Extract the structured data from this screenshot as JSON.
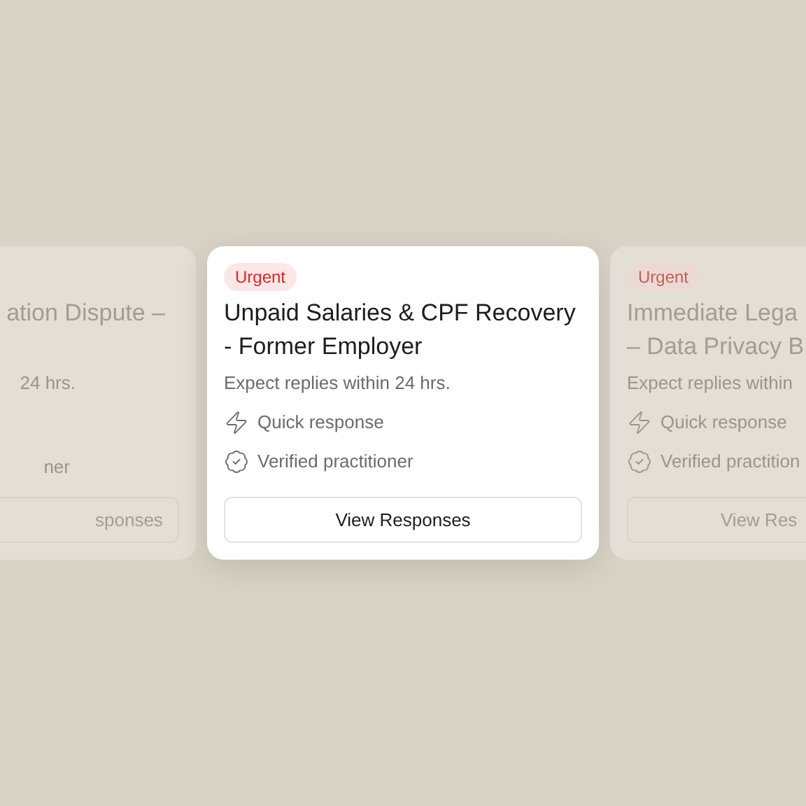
{
  "cards": [
    {
      "kind": "left",
      "title_lines": [
        "ation Dispute –"
      ],
      "subtitle": "24 hrs.",
      "features": [
        {
          "kind": "verified",
          "label": "ner"
        }
      ],
      "button": "sponses"
    },
    {
      "kind": "center",
      "badge": "Urgent",
      "title_lines": [
        "Unpaid Salaries & CPF Recovery",
        "- Former Employer"
      ],
      "subtitle": "Expect replies within 24 hrs.",
      "features": [
        {
          "kind": "quick",
          "label": "Quick response"
        },
        {
          "kind": "verified",
          "label": "Verified practitioner"
        }
      ],
      "button": "View Responses"
    },
    {
      "kind": "right",
      "badge": "Urgent",
      "title_lines": [
        "Immediate Lega",
        "– Data Privacy B"
      ],
      "subtitle": "Expect replies within",
      "features": [
        {
          "kind": "quick",
          "label": "Quick response"
        },
        {
          "kind": "verified",
          "label": "Verified practition"
        }
      ],
      "button": "View Res"
    }
  ]
}
